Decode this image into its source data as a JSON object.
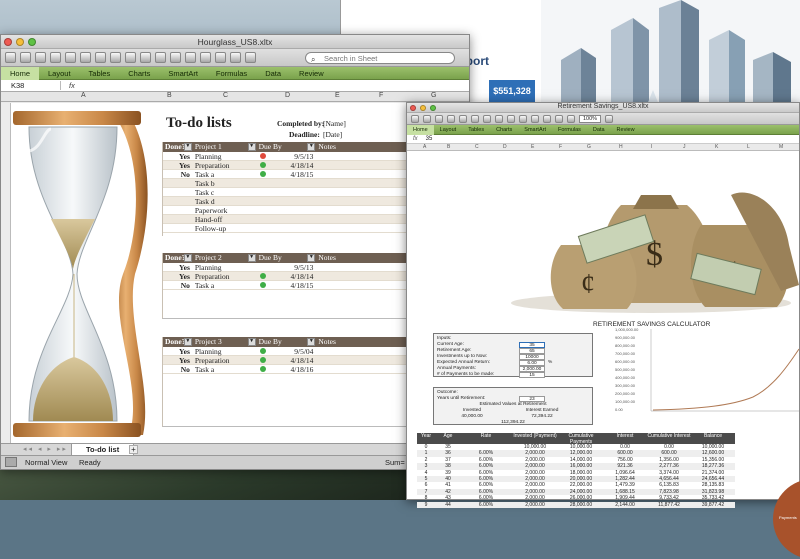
{
  "back_window": {
    "report_heading_fragment": "eport",
    "report_value": "$551,328"
  },
  "main_window": {
    "title": "Hourglass_US8.xltx",
    "search_placeholder": "Search in Sheet",
    "ribbon_tabs": [
      "Home",
      "Layout",
      "Tables",
      "Charts",
      "SmartArt",
      "Formulas",
      "Data",
      "Review"
    ],
    "name_box": "K38",
    "fx_label": "fx",
    "columns": [
      "A",
      "B",
      "C",
      "D",
      "E",
      "F",
      "G"
    ],
    "sheet": {
      "heading": "To-do lists",
      "completed_by_label": "Completed by:",
      "completed_by_value": "[Name]",
      "deadline_label": "Deadline:",
      "deadline_value": "[Date]",
      "headers": [
        "Done?",
        "Due By",
        "Notes"
      ],
      "projects": [
        {
          "name": "Project 1",
          "rows": [
            {
              "done": "Yes",
              "task": "Planning",
              "status": "red",
              "due": "9/5/13"
            },
            {
              "done": "Yes",
              "task": "Preparation",
              "status": "green",
              "due": "4/18/14"
            },
            {
              "done": "No",
              "task": "Task a",
              "status": "green",
              "due": "4/18/15"
            },
            {
              "done": "",
              "task": "Task b",
              "status": "",
              "due": ""
            },
            {
              "done": "",
              "task": "Task c",
              "status": "",
              "due": ""
            },
            {
              "done": "",
              "task": "Task d",
              "status": "",
              "due": ""
            },
            {
              "done": "",
              "task": "Paperwork",
              "status": "",
              "due": ""
            },
            {
              "done": "",
              "task": "Hand-off",
              "status": "",
              "due": ""
            },
            {
              "done": "",
              "task": "Follow-up",
              "status": "",
              "due": ""
            }
          ]
        },
        {
          "name": "Project 2",
          "rows": [
            {
              "done": "Yes",
              "task": "Planning",
              "status": "",
              "due": "9/5/13"
            },
            {
              "done": "Yes",
              "task": "Preparation",
              "status": "green",
              "due": "4/18/14"
            },
            {
              "done": "No",
              "task": "Task a",
              "status": "green",
              "due": "4/18/15"
            }
          ]
        },
        {
          "name": "Project 3",
          "rows": [
            {
              "done": "Yes",
              "task": "Planning",
              "status": "green",
              "due": "9/5/04"
            },
            {
              "done": "Yes",
              "task": "Preparation",
              "status": "green",
              "due": "4/18/14"
            },
            {
              "done": "No",
              "task": "Task a",
              "status": "green",
              "due": "4/18/16"
            }
          ]
        }
      ]
    },
    "sheet_tab": "To-do list",
    "status_view": "Normal View",
    "status_ready": "Ready",
    "status_sum": "Sum="
  },
  "ret_window": {
    "title": "Retirement Savings_US8.xltx",
    "ribbon_tabs": [
      "Home",
      "Layout",
      "Tables",
      "Charts",
      "SmartArt",
      "Formulas",
      "Data",
      "Review"
    ],
    "zoom": "100%",
    "formula_value": "35",
    "columns": [
      "A",
      "B",
      "C",
      "D",
      "E",
      "F",
      "G",
      "H",
      "I",
      "J",
      "K",
      "L",
      "M"
    ],
    "calc_title": "RETIREMENT SAVINGS CALCULATOR",
    "inputs": {
      "title": "Inputs:",
      "rows": [
        {
          "label": "Current Age:",
          "value": "35",
          "unit": ""
        },
        {
          "label": "Retirement Age:",
          "value": "65",
          "unit": ""
        },
        {
          "label": "Investments up to Now:",
          "value": "10000",
          "unit": ""
        },
        {
          "label": "Expected Annual Return:",
          "value": "6.00",
          "unit": "%"
        },
        {
          "label": "Annual Payments:",
          "value": "2,000.00",
          "unit": ""
        },
        {
          "label": "# of Payments to be made:",
          "value": "15",
          "unit": ""
        }
      ]
    },
    "outcome": {
      "title": "Outcome:",
      "years_label": "Years until Retirement:",
      "years_value": "23",
      "estimated_label": "Estimated Values at Retirement",
      "invested_label": "Invested",
      "interest_label": "Interest Earned",
      "invested_value": "40,000.00",
      "interest_value": "72,394.22",
      "total_value": "112,394.22"
    },
    "chart_axis": [
      "1,000,000.00",
      "900,000.00",
      "800,000.00",
      "700,000.00",
      "600,000.00",
      "500,000.00",
      "400,000.00",
      "300,000.00",
      "200,000.00",
      "100,000.00",
      "0.00"
    ],
    "table_headers": [
      "Year",
      "Age",
      "Rate",
      "Invested (Payment)",
      "Cumulative Payments",
      "Interest",
      "Cumulative Interest",
      "Balance"
    ],
    "table_rows": [
      [
        "0",
        "35",
        "",
        "10,000.00",
        "10,000.00",
        "0.00",
        "0.00",
        "10,000.00"
      ],
      [
        "1",
        "36",
        "6.00%",
        "2,000.00",
        "12,000.00",
        "600.00",
        "600.00",
        "12,600.00"
      ],
      [
        "2",
        "37",
        "6.00%",
        "2,000.00",
        "14,000.00",
        "756.00",
        "1,356.00",
        "15,356.00"
      ],
      [
        "3",
        "38",
        "6.00%",
        "2,000.00",
        "16,000.00",
        "921.36",
        "2,277.36",
        "18,277.36"
      ],
      [
        "4",
        "39",
        "6.00%",
        "2,000.00",
        "18,000.00",
        "1,096.64",
        "3,374.00",
        "21,374.00"
      ],
      [
        "5",
        "40",
        "6.00%",
        "2,000.00",
        "20,000.00",
        "1,282.44",
        "4,656.44",
        "24,656.44"
      ],
      [
        "6",
        "41",
        "6.00%",
        "2,000.00",
        "22,000.00",
        "1,479.39",
        "6,135.83",
        "28,135.83"
      ],
      [
        "7",
        "42",
        "6.00%",
        "2,000.00",
        "24,000.00",
        "1,688.15",
        "7,823.98",
        "31,823.98"
      ],
      [
        "8",
        "43",
        "6.00%",
        "2,000.00",
        "26,000.00",
        "1,909.44",
        "9,733.42",
        "35,733.42"
      ],
      [
        "9",
        "44",
        "6.00%",
        "2,000.00",
        "28,000.00",
        "2,144.00",
        "11,877.42",
        "39,877.42"
      ]
    ],
    "pie_label": "Payments"
  }
}
